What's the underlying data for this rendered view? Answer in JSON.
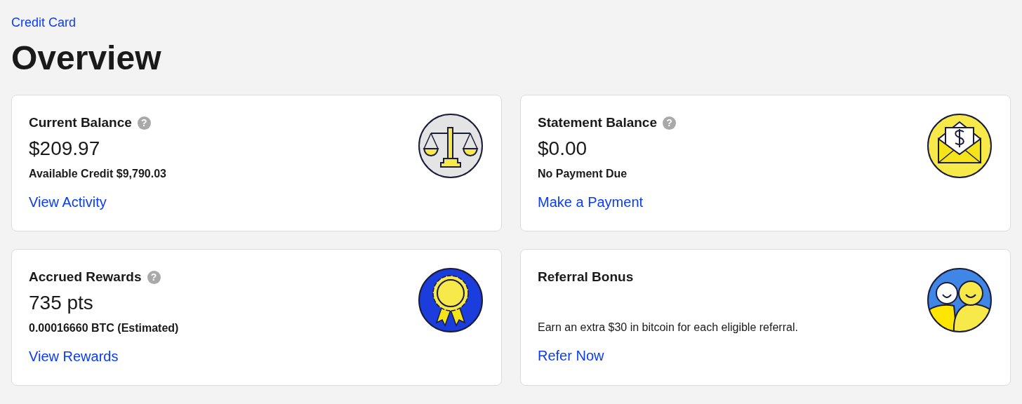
{
  "breadcrumb": "Credit Card",
  "title": "Overview",
  "cards": [
    {
      "title": "Current Balance",
      "help": "?",
      "value": "$209.97",
      "note": "Available Credit $9,790.03",
      "link": "View Activity"
    },
    {
      "title": "Statement Balance",
      "help": "?",
      "value": "$0.00",
      "note": "No Payment Due",
      "link": "Make a Payment"
    },
    {
      "title": "Accrued Rewards",
      "help": "?",
      "value": "735 pts",
      "note": "0.00016660 BTC (Estimated)",
      "link": "View Rewards"
    },
    {
      "title": "Referral Bonus",
      "description": "Earn an extra $30 in bitcoin for each eligible referral.",
      "link": "Refer Now"
    }
  ]
}
